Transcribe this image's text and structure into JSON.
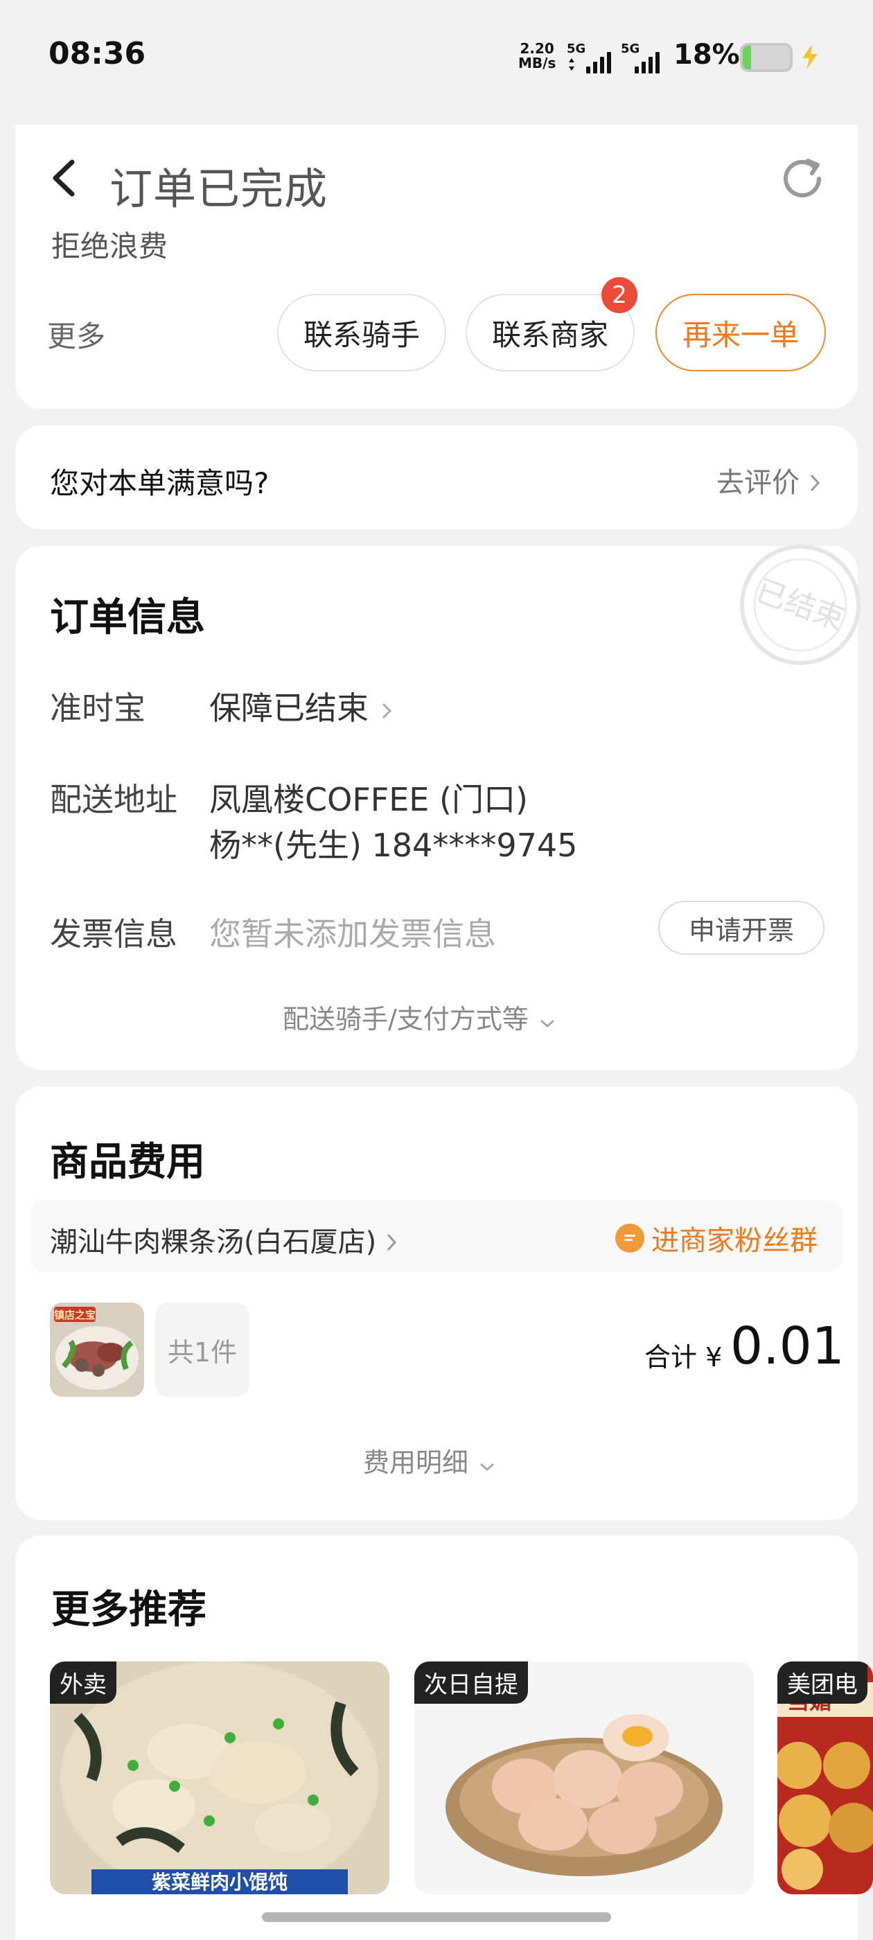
{
  "status_bar": {
    "time": "08:36",
    "net_speed_value": "2.20",
    "net_speed_unit": "MB/s",
    "signal1": "5G",
    "signal2": "5G",
    "battery": "18%",
    "battery_level": 0.18
  },
  "header": {
    "title": "订单已完成"
  },
  "top_card": {
    "cut_text": "拒绝浪费",
    "more": "更多",
    "contact_rider": "联系骑手",
    "contact_merchant": "联系商家",
    "merchant_badge": "2",
    "order_again": "再来一单"
  },
  "satisfaction": {
    "question": "您对本单满意吗?",
    "action": "去评价"
  },
  "order_info": {
    "title": "订单信息",
    "stamp": "已结束",
    "ontime_label": "准时宝",
    "ontime_value": "保障已结束",
    "address_label": "配送地址",
    "address_line1": "凤凰楼COFFEE (门口)",
    "address_line2": "杨**(先生) 184****9745",
    "invoice_label": "发票信息",
    "invoice_value": "您暂未添加发票信息",
    "invoice_button": "申请开票",
    "expand": "配送骑手/支付方式等"
  },
  "goods_fee": {
    "title": "商品费用",
    "shop_name": "潮汕牛肉粿条汤(白石厦店)",
    "fans_group": "进商家粉丝群",
    "thumb_label": "镇店之宝",
    "item_count": "共1件",
    "total_label": "合计",
    "currency": "¥",
    "total_value": "0.01",
    "fee_detail": "费用明细"
  },
  "recommend": {
    "title": "更多推荐",
    "items": [
      {
        "tag": "外卖",
        "caption": "紫菜鲜肉小馄饨"
      },
      {
        "tag": "次日自提"
      },
      {
        "tag": "美团电",
        "caption": "当媚"
      }
    ]
  },
  "colors": {
    "accent": "#ee7a1c",
    "badge": "#ec4b38",
    "battery": "#6cd35a"
  }
}
